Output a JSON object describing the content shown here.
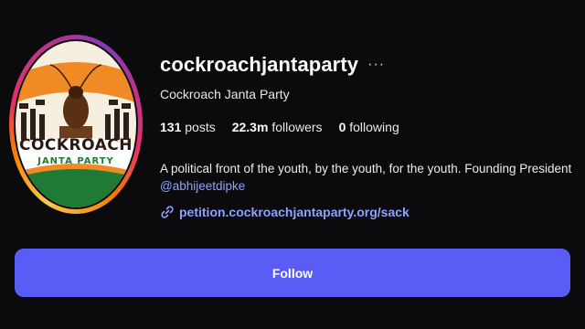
{
  "profile": {
    "username": "cockroachjantaparty",
    "more_icon": "···",
    "display_name": "Cockroach Janta Party",
    "stats": {
      "posts_count": "131",
      "posts_label": "posts",
      "followers_count": "22.3m",
      "followers_label": "followers",
      "following_count": "0",
      "following_label": "following"
    },
    "bio": "A political front of the youth, by the youth, for the youth. Founding President",
    "bio_mention": "@abhijeetdipke",
    "link": "petition.cockroachjantaparty.org/sack",
    "link_icon": "link-icon",
    "avatar": {
      "logo_line1": "COCKROACH",
      "logo_line2": "JANTA PARTY"
    }
  },
  "actions": {
    "follow_label": "Follow"
  },
  "colors": {
    "background": "#0b0b0d",
    "follow_button": "#5a5cf6",
    "link": "#8ea2ff",
    "saffron": "#f08a24",
    "green": "#1f7a35"
  }
}
